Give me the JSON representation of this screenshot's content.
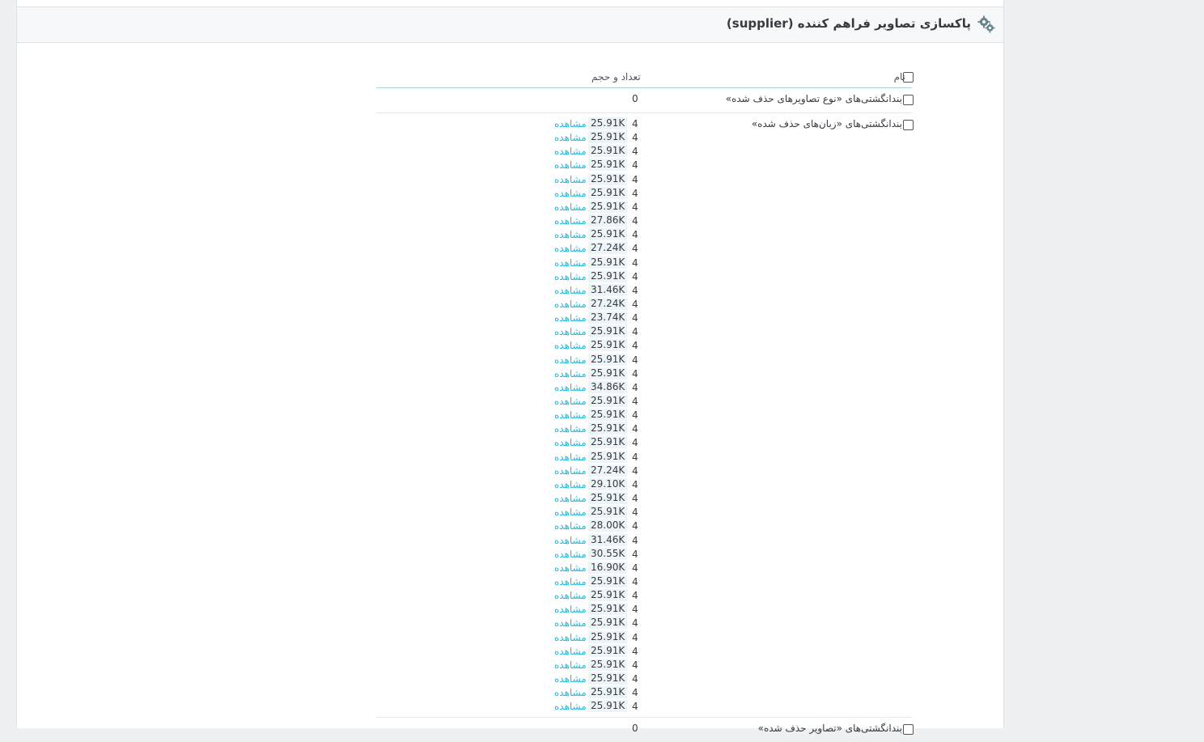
{
  "header": {
    "title": "پاکسازی تصاویر فراهم کننده (supplier)",
    "icon": "gear-icon"
  },
  "table": {
    "col_name": "نام",
    "col_count_size": "تعداد و حجم",
    "rows": [
      {
        "label": "بندانگشتی‌های «نوع تصاویرهای حذف شده»",
        "count": "0"
      },
      {
        "label": "بندانگشتی‌های «زبان‌های حذف شده»"
      },
      {
        "label": "بندانگشتی‌های «تصاویر حذف شده»",
        "count": "0"
      }
    ],
    "view_label": "مشاهده",
    "entries": [
      {
        "n": "4",
        "size": "25.91K"
      },
      {
        "n": "4",
        "size": "25.91K"
      },
      {
        "n": "4",
        "size": "25.91K"
      },
      {
        "n": "4",
        "size": "25.91K"
      },
      {
        "n": "4",
        "size": "25.91K"
      },
      {
        "n": "4",
        "size": "25.91K"
      },
      {
        "n": "4",
        "size": "25.91K"
      },
      {
        "n": "4",
        "size": "27.86K"
      },
      {
        "n": "4",
        "size": "25.91K"
      },
      {
        "n": "4",
        "size": "27.24K"
      },
      {
        "n": "4",
        "size": "25.91K"
      },
      {
        "n": "4",
        "size": "25.91K"
      },
      {
        "n": "4",
        "size": "31.46K"
      },
      {
        "n": "4",
        "size": "27.24K"
      },
      {
        "n": "4",
        "size": "23.74K"
      },
      {
        "n": "4",
        "size": "25.91K"
      },
      {
        "n": "4",
        "size": "25.91K"
      },
      {
        "n": "4",
        "size": "25.91K"
      },
      {
        "n": "4",
        "size": "25.91K"
      },
      {
        "n": "4",
        "size": "34.86K"
      },
      {
        "n": "4",
        "size": "25.91K"
      },
      {
        "n": "4",
        "size": "25.91K"
      },
      {
        "n": "4",
        "size": "25.91K"
      },
      {
        "n": "4",
        "size": "25.91K"
      },
      {
        "n": "4",
        "size": "25.91K"
      },
      {
        "n": "4",
        "size": "27.24K"
      },
      {
        "n": "4",
        "size": "29.10K"
      },
      {
        "n": "4",
        "size": "25.91K"
      },
      {
        "n": "4",
        "size": "25.91K"
      },
      {
        "n": "4",
        "size": "28.00K"
      },
      {
        "n": "4",
        "size": "31.46K"
      },
      {
        "n": "4",
        "size": "30.55K"
      },
      {
        "n": "4",
        "size": "16.90K"
      },
      {
        "n": "4",
        "size": "25.91K"
      },
      {
        "n": "4",
        "size": "25.91K"
      },
      {
        "n": "4",
        "size": "25.91K"
      },
      {
        "n": "4",
        "size": "25.91K"
      },
      {
        "n": "4",
        "size": "25.91K"
      },
      {
        "n": "4",
        "size": "25.91K"
      },
      {
        "n": "4",
        "size": "25.91K"
      },
      {
        "n": "4",
        "size": "25.91K"
      },
      {
        "n": "4",
        "size": "25.91K"
      },
      {
        "n": "4",
        "size": "25.91K"
      }
    ]
  }
}
